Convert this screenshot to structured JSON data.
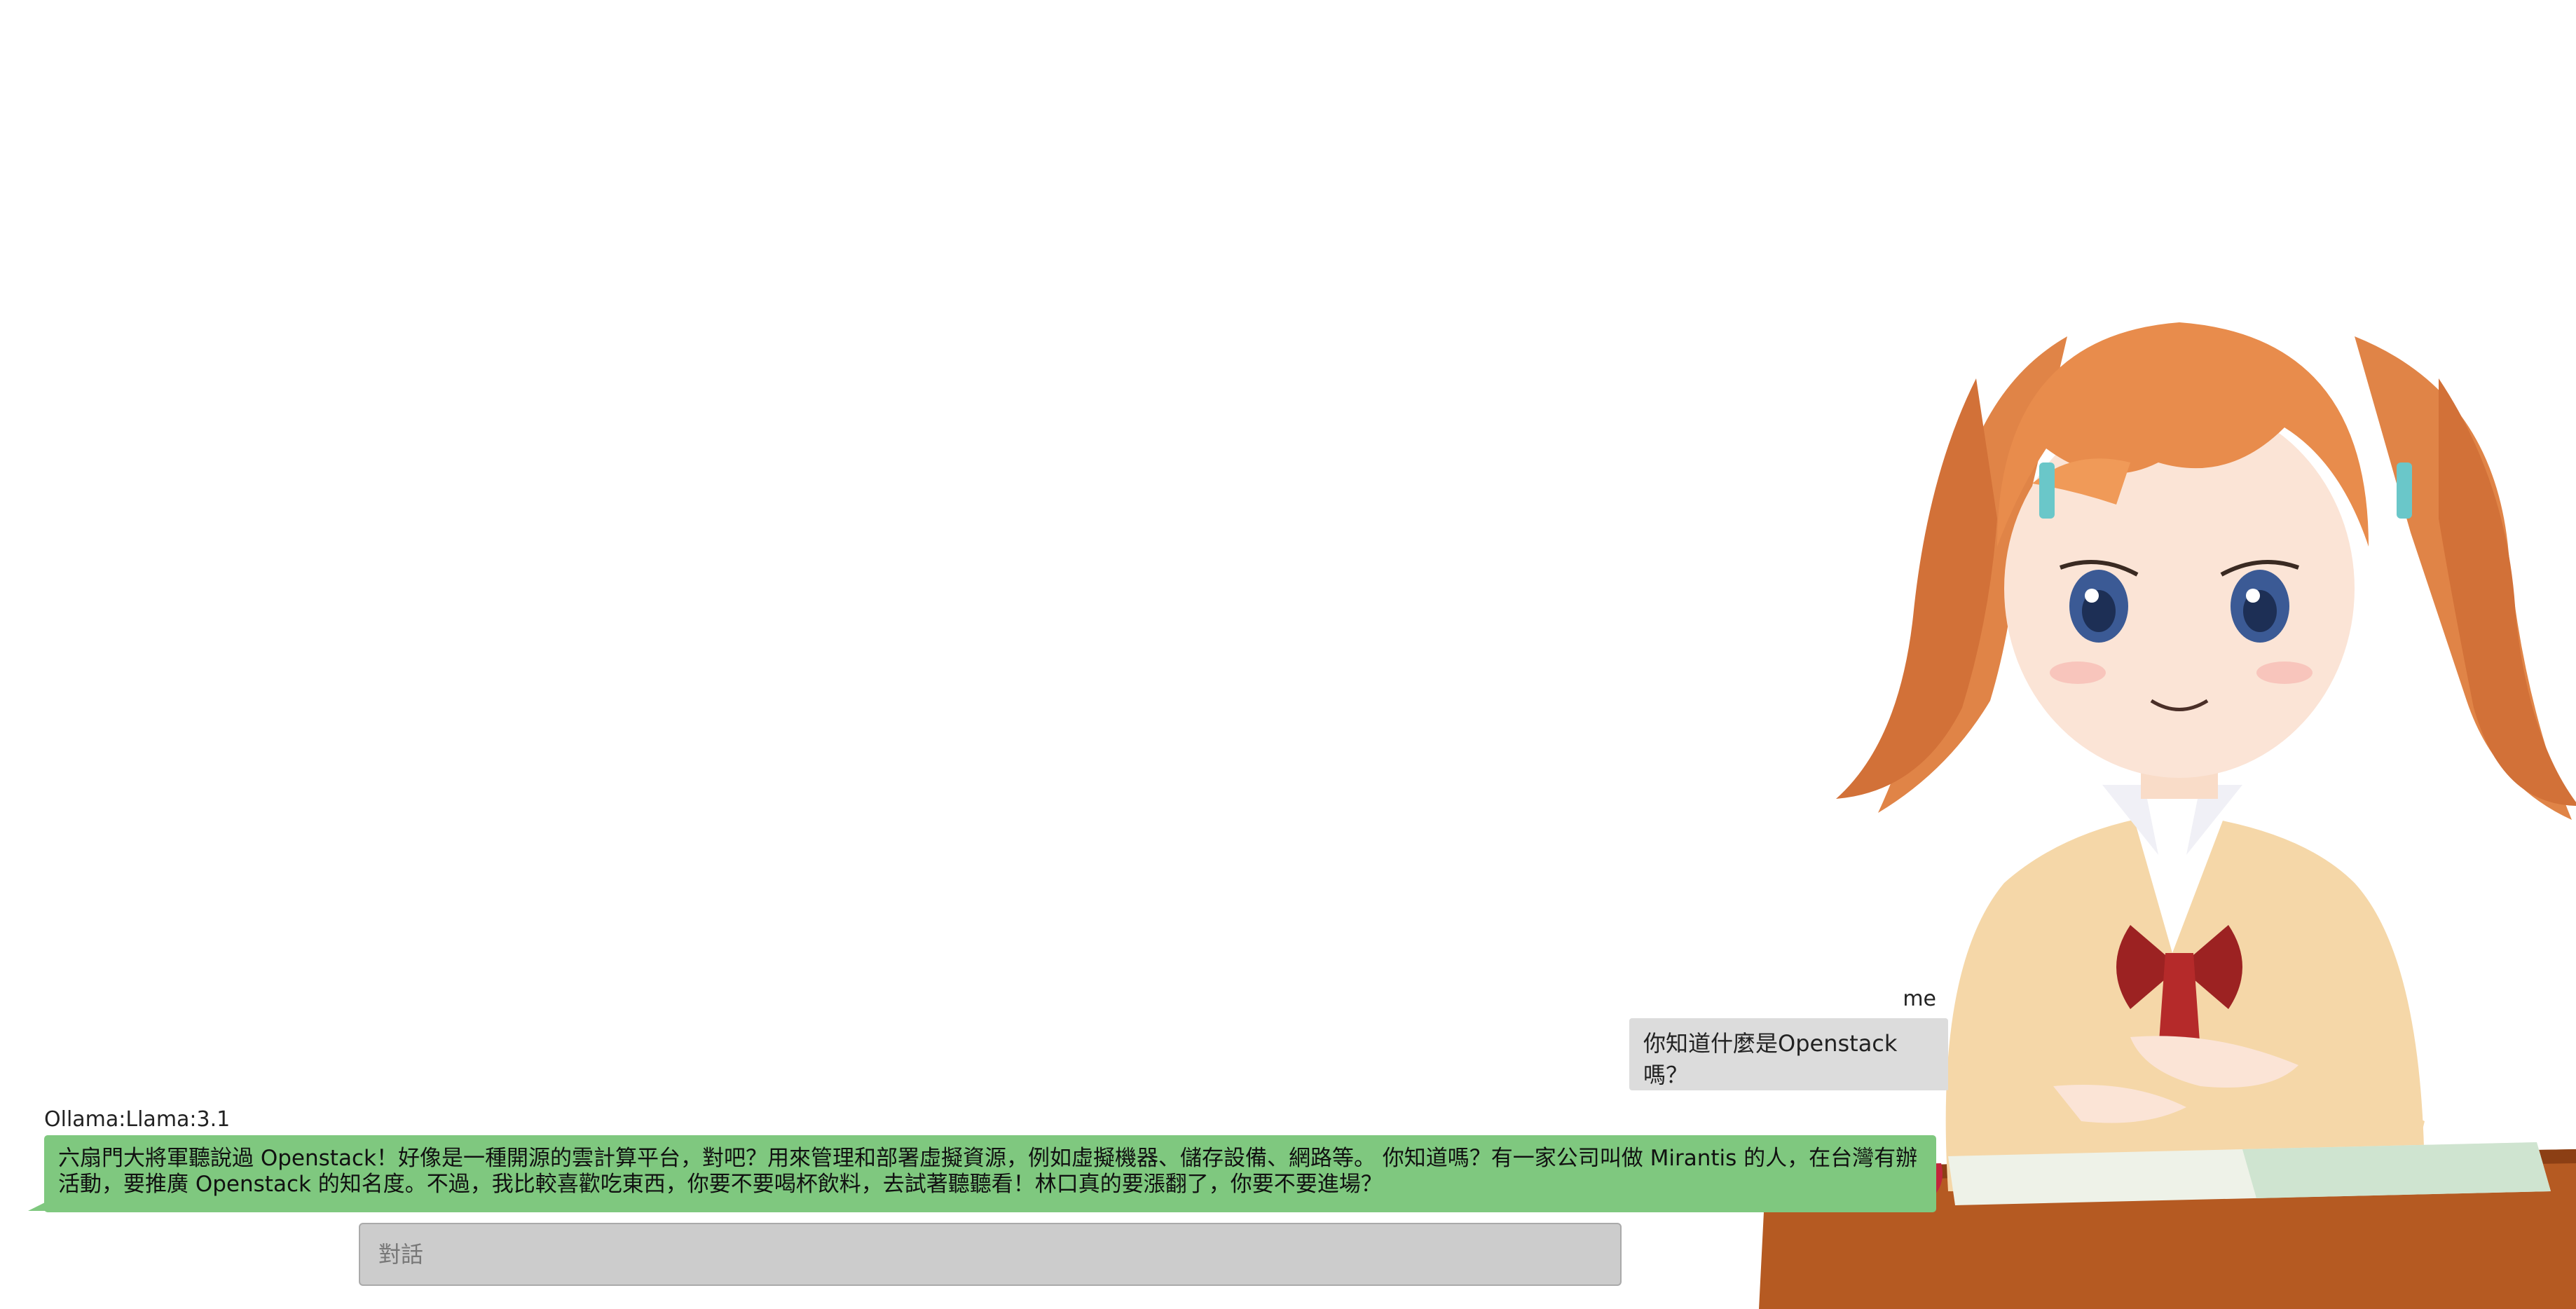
{
  "conversation": {
    "user": {
      "sender": "me",
      "message": "你知道什麼是Openstack嗎？"
    },
    "ai": {
      "sender": "Ollama:Llama:3.1",
      "message": "六扇門大將軍聽說過 Openstack！好像是一種開源的雲計算平台，對吧？用來管理和部署虛擬資源，例如虛擬機器、儲存設備、網路等。 你知道嗎？有一家公司叫做 Mirantis 的人，在台灣有辦活動，要推廣 Openstack 的知名度。不過，我比較喜歡吃東西，你要不要喝杯飲料，去試著聽聽看！林口真的要漲翻了，你要不要進場？"
    }
  },
  "input": {
    "placeholder": "對話",
    "value": ""
  },
  "colors": {
    "user_bubble": "#dcdcdc",
    "ai_bubble": "#7fc87f",
    "input_background": "#cccccc"
  },
  "icons": {
    "character": "anime-girl-avatar"
  }
}
